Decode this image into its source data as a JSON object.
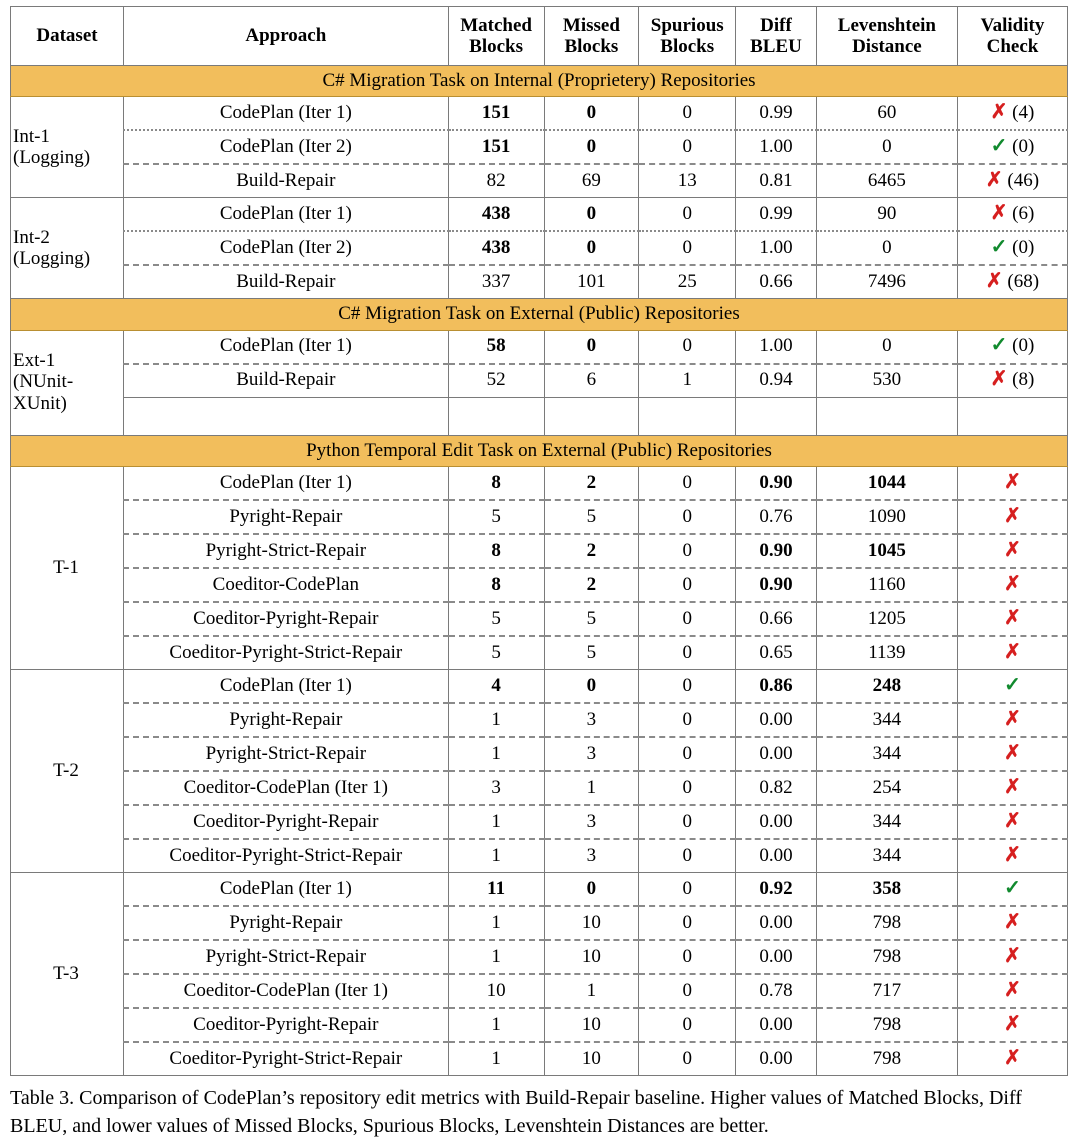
{
  "table": {
    "columns": [
      {
        "id": "dataset",
        "line1": "Dataset",
        "line2": ""
      },
      {
        "id": "approach",
        "line1": "Approach",
        "line2": ""
      },
      {
        "id": "matched",
        "line1": "Matched",
        "line2": "Blocks"
      },
      {
        "id": "missed",
        "line1": "Missed",
        "line2": "Blocks"
      },
      {
        "id": "spurious",
        "line1": "Spurious",
        "line2": "Blocks"
      },
      {
        "id": "diff",
        "line1": "Diff",
        "line2": "BLEU"
      },
      {
        "id": "lev",
        "line1": "Levenshtein",
        "line2": "Distance"
      },
      {
        "id": "valid",
        "line1": "Validity",
        "line2": "Check"
      }
    ],
    "sections": [
      {
        "title": "C# Migration Task on Internal (Proprietery) Repositories",
        "groups": [
          {
            "dataset_lines": [
              "Int-1",
              "(Logging)"
            ],
            "dataset_align": "left",
            "rows": [
              {
                "approach": "CodePlan (Iter 1)",
                "matched": "151",
                "missed": "0",
                "spurious": "0",
                "diff": "0.99",
                "lev": "60",
                "valid_mark": "cross",
                "valid_count": "(4)",
                "bold": [
                  "matched",
                  "missed"
                ],
                "sep": "none"
              },
              {
                "approach": "CodePlan (Iter 2)",
                "matched": "151",
                "missed": "0",
                "spurious": "0",
                "diff": "1.00",
                "lev": "0",
                "valid_mark": "check",
                "valid_count": "(0)",
                "bold": [
                  "matched",
                  "missed"
                ],
                "sep": "dotted"
              },
              {
                "approach": "Build-Repair",
                "matched": "82",
                "missed": "69",
                "spurious": "13",
                "diff": "0.81",
                "lev": "6465",
                "valid_mark": "cross",
                "valid_count": "(46)",
                "bold": [],
                "sep": "dashed"
              }
            ]
          },
          {
            "dataset_lines": [
              "Int-2",
              "(Logging)"
            ],
            "dataset_align": "left",
            "rows": [
              {
                "approach": "CodePlan (Iter 1)",
                "matched": "438",
                "missed": "0",
                "spurious": "0",
                "diff": "0.99",
                "lev": "90",
                "valid_mark": "cross",
                "valid_count": "(6)",
                "bold": [
                  "matched",
                  "missed"
                ],
                "sep": "none"
              },
              {
                "approach": "CodePlan (Iter 2)",
                "matched": "438",
                "missed": "0",
                "spurious": "0",
                "diff": "1.00",
                "lev": "0",
                "valid_mark": "check",
                "valid_count": "(0)",
                "bold": [
                  "matched",
                  "missed"
                ],
                "sep": "dotted"
              },
              {
                "approach": "Build-Repair",
                "matched": "337",
                "missed": "101",
                "spurious": "25",
                "diff": "0.66",
                "lev": "7496",
                "valid_mark": "cross",
                "valid_count": "(68)",
                "bold": [],
                "sep": "dashed"
              }
            ]
          }
        ]
      },
      {
        "title": "C# Migration Task on External (Public) Repositories",
        "groups": [
          {
            "dataset_lines": [
              "Ext-1",
              "(NUnit-",
              "XUnit)"
            ],
            "dataset_align": "left",
            "filler_rows": 1,
            "rows": [
              {
                "approach": "CodePlan (Iter 1)",
                "matched": "58",
                "missed": "0",
                "spurious": "0",
                "diff": "1.00",
                "lev": "0",
                "valid_mark": "check",
                "valid_count": "(0)",
                "bold": [
                  "matched",
                  "missed"
                ],
                "sep": "none"
              },
              {
                "approach": "Build-Repair",
                "matched": "52",
                "missed": "6",
                "spurious": "1",
                "diff": "0.94",
                "lev": "530",
                "valid_mark": "cross",
                "valid_count": "(8)",
                "bold": [],
                "sep": "dashed"
              }
            ]
          }
        ]
      },
      {
        "title": "Python Temporal Edit Task on External (Public) Repositories",
        "groups": [
          {
            "dataset_lines": [
              "T-1"
            ],
            "dataset_align": "center",
            "rows": [
              {
                "approach": "CodePlan (Iter 1)",
                "matched": "8",
                "missed": "2",
                "spurious": "0",
                "diff": "0.90",
                "lev": "1044",
                "valid_mark": "cross",
                "valid_count": "",
                "bold": [
                  "matched",
                  "missed",
                  "diff",
                  "lev"
                ],
                "sep": "none"
              },
              {
                "approach": "Pyright-Repair",
                "matched": "5",
                "missed": "5",
                "spurious": "0",
                "diff": "0.76",
                "lev": "1090",
                "valid_mark": "cross",
                "valid_count": "",
                "bold": [],
                "sep": "dashed"
              },
              {
                "approach": "Pyright-Strict-Repair",
                "matched": "8",
                "missed": "2",
                "spurious": "0",
                "diff": "0.90",
                "lev": "1045",
                "valid_mark": "cross",
                "valid_count": "",
                "bold": [
                  "matched",
                  "missed",
                  "diff",
                  "lev"
                ],
                "sep": "dashed"
              },
              {
                "approach": "Coeditor-CodePlan",
                "matched": "8",
                "missed": "2",
                "spurious": "0",
                "diff": "0.90",
                "lev": "1160",
                "valid_mark": "cross",
                "valid_count": "",
                "bold": [
                  "matched",
                  "missed",
                  "diff"
                ],
                "sep": "dashed"
              },
              {
                "approach": "Coeditor-Pyright-Repair",
                "matched": "5",
                "missed": "5",
                "spurious": "0",
                "diff": "0.66",
                "lev": "1205",
                "valid_mark": "cross",
                "valid_count": "",
                "bold": [],
                "sep": "dashed"
              },
              {
                "approach": "Coeditor-Pyright-Strict-Repair",
                "matched": "5",
                "missed": "5",
                "spurious": "0",
                "diff": "0.65",
                "lev": "1139",
                "valid_mark": "cross",
                "valid_count": "",
                "bold": [],
                "sep": "dashed"
              }
            ]
          },
          {
            "dataset_lines": [
              "T-2"
            ],
            "dataset_align": "center",
            "rows": [
              {
                "approach": "CodePlan (Iter 1)",
                "matched": "4",
                "missed": "0",
                "spurious": "0",
                "diff": "0.86",
                "lev": "248",
                "valid_mark": "check",
                "valid_count": "",
                "bold": [
                  "matched",
                  "missed",
                  "diff",
                  "lev"
                ],
                "sep": "none"
              },
              {
                "approach": "Pyright-Repair",
                "matched": "1",
                "missed": "3",
                "spurious": "0",
                "diff": "0.00",
                "lev": "344",
                "valid_mark": "cross",
                "valid_count": "",
                "bold": [],
                "sep": "dashed"
              },
              {
                "approach": "Pyright-Strict-Repair",
                "matched": "1",
                "missed": "3",
                "spurious": "0",
                "diff": "0.00",
                "lev": "344",
                "valid_mark": "cross",
                "valid_count": "",
                "bold": [],
                "sep": "dashed"
              },
              {
                "approach": "Coeditor-CodePlan (Iter 1)",
                "matched": "3",
                "missed": "1",
                "spurious": "0",
                "diff": "0.82",
                "lev": "254",
                "valid_mark": "cross",
                "valid_count": "",
                "bold": [],
                "sep": "dashed"
              },
              {
                "approach": "Coeditor-Pyright-Repair",
                "matched": "1",
                "missed": "3",
                "spurious": "0",
                "diff": "0.00",
                "lev": "344",
                "valid_mark": "cross",
                "valid_count": "",
                "bold": [],
                "sep": "dashed"
              },
              {
                "approach": "Coeditor-Pyright-Strict-Repair",
                "matched": "1",
                "missed": "3",
                "spurious": "0",
                "diff": "0.00",
                "lev": "344",
                "valid_mark": "cross",
                "valid_count": "",
                "bold": [],
                "sep": "dashed"
              }
            ]
          },
          {
            "dataset_lines": [
              "T-3"
            ],
            "dataset_align": "center",
            "rows": [
              {
                "approach": "CodePlan (Iter 1)",
                "matched": "11",
                "missed": "0",
                "spurious": "0",
                "diff": "0.92",
                "lev": "358",
                "valid_mark": "check",
                "valid_count": "",
                "bold": [
                  "matched",
                  "missed",
                  "diff",
                  "lev"
                ],
                "sep": "none"
              },
              {
                "approach": "Pyright-Repair",
                "matched": "1",
                "missed": "10",
                "spurious": "0",
                "diff": "0.00",
                "lev": "798",
                "valid_mark": "cross",
                "valid_count": "",
                "bold": [],
                "sep": "dashed"
              },
              {
                "approach": "Pyright-Strict-Repair",
                "matched": "1",
                "missed": "10",
                "spurious": "0",
                "diff": "0.00",
                "lev": "798",
                "valid_mark": "cross",
                "valid_count": "",
                "bold": [],
                "sep": "dashed"
              },
              {
                "approach": "Coeditor-CodePlan (Iter 1)",
                "matched": "10",
                "missed": "1",
                "spurious": "0",
                "diff": "0.78",
                "lev": "717",
                "valid_mark": "cross",
                "valid_count": "",
                "bold": [],
                "sep": "dashed"
              },
              {
                "approach": "Coeditor-Pyright-Repair",
                "matched": "1",
                "missed": "10",
                "spurious": "0",
                "diff": "0.00",
                "lev": "798",
                "valid_mark": "cross",
                "valid_count": "",
                "bold": [],
                "sep": "dashed"
              },
              {
                "approach": "Coeditor-Pyright-Strict-Repair",
                "matched": "1",
                "missed": "10",
                "spurious": "0",
                "diff": "0.00",
                "lev": "798",
                "valid_mark": "cross",
                "valid_count": "",
                "bold": [],
                "sep": "dashed"
              }
            ]
          }
        ]
      }
    ]
  },
  "marks": {
    "cross_glyph": "✗",
    "check_glyph": "✓",
    "cross_color": "#d61f1f",
    "check_color": "#118a2e"
  },
  "colors": {
    "section_banner": "#f2be5c",
    "section_banner_border": "#b98f32",
    "grid_line": "#7a7a7a",
    "separator": "#8a8a8a"
  },
  "caption": {
    "label": "Table 3.",
    "text": "Comparison of CodePlan’s repository edit metrics with Build-Repair baseline. Higher values of Matched Blocks, Diff BLEU, and lower values of Missed Blocks, Spurious Blocks, Levenshtein Distances are better."
  }
}
